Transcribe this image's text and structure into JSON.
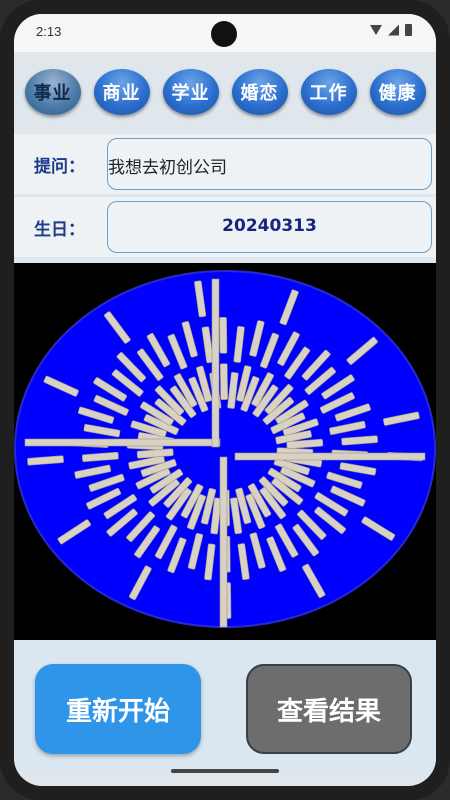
{
  "status": {
    "time": "2:13"
  },
  "tabs": [
    {
      "label": "事业",
      "active": true
    },
    {
      "label": "商业",
      "active": false
    },
    {
      "label": "学业",
      "active": false
    },
    {
      "label": "婚恋",
      "active": false
    },
    {
      "label": "工作",
      "active": false
    },
    {
      "label": "健康",
      "active": false
    }
  ],
  "question": {
    "label": "提问：",
    "value": "我想去初创公司"
  },
  "birthday": {
    "label": "生日：",
    "value": "20240313"
  },
  "board": {
    "stick_count": 50,
    "disc_color": "#0000ff"
  },
  "buttons": {
    "restart": "重新开始",
    "result": "查看结果"
  }
}
